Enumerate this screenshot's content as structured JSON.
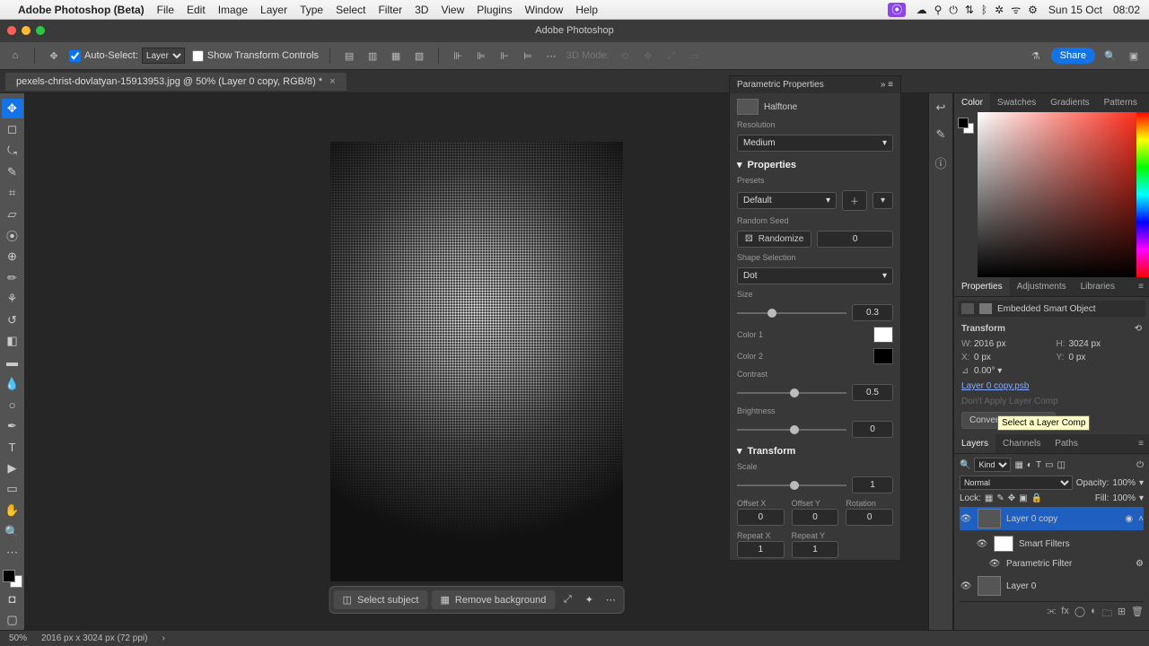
{
  "menubar": {
    "app": "Adobe Photoshop (Beta)",
    "items": [
      "File",
      "Edit",
      "Image",
      "Layer",
      "Type",
      "Select",
      "Filter",
      "3D",
      "View",
      "Plugins",
      "Window",
      "Help"
    ],
    "date": "Sun 15 Oct",
    "time": "08:02"
  },
  "window": {
    "title": "Adobe Photoshop"
  },
  "options": {
    "auto_select": "Auto-Select:",
    "auto_select_mode": "Layer",
    "show_transform": "Show Transform Controls",
    "mode_3d": "3D Mode:",
    "share": "Share"
  },
  "tab": {
    "name": "pexels-christ-dovlatyan-15913953.jpg @ 50% (Layer 0 copy, RGB/8) *"
  },
  "contextbar": {
    "select_subject": "Select subject",
    "remove_bg": "Remove background"
  },
  "parametric": {
    "title": "Parametric Properties",
    "filter_name": "Halftone",
    "resolution_label": "Resolution",
    "resolution": "Medium",
    "properties_hdr": "Properties",
    "presets_label": "Presets",
    "preset": "Default",
    "random_seed_label": "Random Seed",
    "randomize": "Randomize",
    "seed": "0",
    "shape_label": "Shape Selection",
    "shape": "Dot",
    "size_label": "Size",
    "size": "0.3",
    "color1_label": "Color 1",
    "color2_label": "Color 2",
    "contrast_label": "Contrast",
    "contrast": "0.5",
    "brightness_label": "Brightness",
    "brightness": "0",
    "transform_hdr": "Transform",
    "scale_label": "Scale",
    "scale": "1",
    "offsetx_label": "Offset X",
    "offsety_label": "Offset Y",
    "rotation_label": "Rotation",
    "offsetx": "0",
    "offsety": "0",
    "rotation": "0",
    "repeatx_label": "Repeat X",
    "repeaty_label": "Repeat Y",
    "repeatx": "1",
    "repeaty": "1"
  },
  "right_tabs_color": [
    "Color",
    "Swatches",
    "Gradients",
    "Patterns"
  ],
  "right_tabs_props": [
    "Properties",
    "Adjustments",
    "Libraries"
  ],
  "right_tabs_layers": [
    "Layers",
    "Channels",
    "Paths"
  ],
  "properties_panel": {
    "type": "Embedded Smart Object",
    "transform_hdr": "Transform",
    "w_lbl": "W:",
    "w": "2016 px",
    "h_lbl": "H:",
    "h": "3024 px",
    "x_lbl": "X:",
    "x": "0 px",
    "y_lbl": "Y:",
    "y": "0 px",
    "angle_lbl": "⊿",
    "angle": "0.00°",
    "src": "Layer 0 copy.psb",
    "layer_comp_disabled": "Don't Apply Layer Comp",
    "tooltip": "Select a Layer Comp",
    "convert": "Convert to Linked..."
  },
  "layers": {
    "kind": "Kind",
    "blend": "Normal",
    "opacity_lbl": "Opacity:",
    "opacity": "100%",
    "lock_lbl": "Lock:",
    "fill_lbl": "Fill:",
    "fill": "100%",
    "l0copy": "Layer 0 copy",
    "smart_filters": "Smart Filters",
    "param_filter": "Parametric Filter",
    "l0": "Layer 0"
  },
  "status": {
    "zoom": "50%",
    "dims": "2016 px x 3024 px (72 ppi)"
  }
}
